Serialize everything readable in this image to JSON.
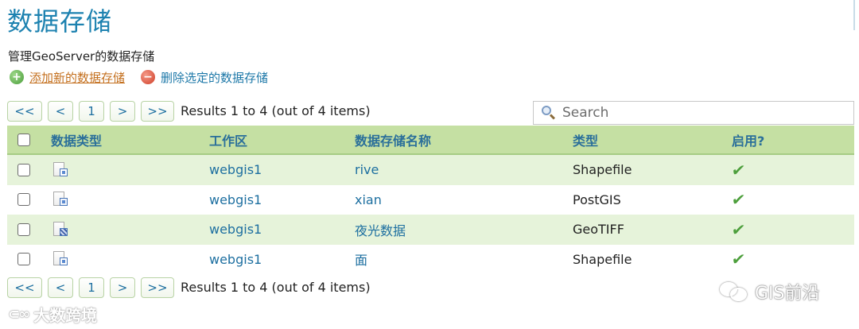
{
  "page": {
    "title": "数据存储",
    "subtitle": "管理GeoServer的数据存储"
  },
  "actions": {
    "add_label": "添加新的数据存储",
    "remove_label": "删除选定的数据存储"
  },
  "pager": {
    "first": "<<",
    "prev": "<",
    "current": "1",
    "next": ">",
    "last": ">>",
    "summary": "Results 1 to 4 (out of 4 items)"
  },
  "search": {
    "placeholder": "Search"
  },
  "table": {
    "columns": {
      "type_icon": "数据类型",
      "workspace": "工作区",
      "name": "数据存储名称",
      "type": "类型",
      "enabled": "启用?"
    },
    "rows": [
      {
        "icon": "vector-store-icon",
        "workspace": "webgis1",
        "name": "rive",
        "type": "Shapefile",
        "enabled": "✔"
      },
      {
        "icon": "database-store-icon",
        "workspace": "webgis1",
        "name": "xian",
        "type": "PostGIS",
        "enabled": "✔"
      },
      {
        "icon": "raster-store-icon",
        "workspace": "webgis1",
        "name": "夜光数据",
        "type": "GeoTIFF",
        "enabled": "✔"
      },
      {
        "icon": "vector-store-icon",
        "workspace": "webgis1",
        "name": "面",
        "type": "Shapefile",
        "enabled": "✔"
      }
    ]
  },
  "watermarks": {
    "left": "大数跨境",
    "right": "GIS前沿"
  },
  "colors": {
    "title": "#1d82b0",
    "header_bg": "#c5e0a3",
    "odd_row_bg": "#e6f3da",
    "link": "#1d6fa0",
    "add_link": "#c4701f",
    "check": "#4d9f3c"
  }
}
